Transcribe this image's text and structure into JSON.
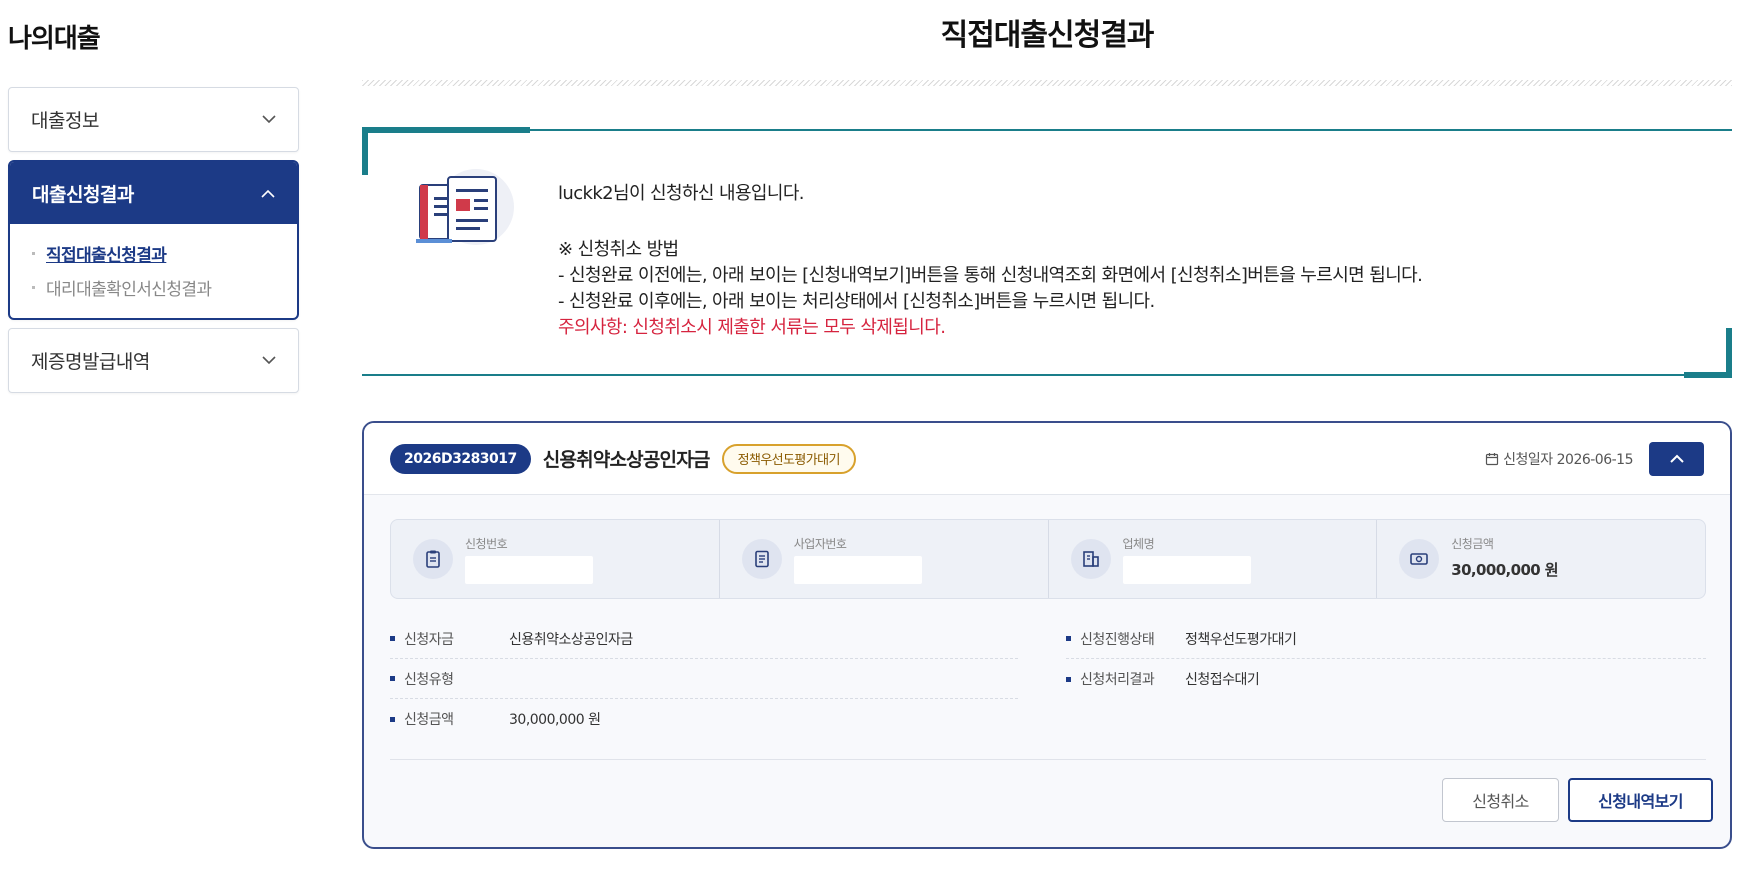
{
  "sidebar": {
    "title": "나의대출",
    "menus": [
      {
        "label": "대출정보"
      },
      {
        "label": "대출신청결과",
        "sub": [
          "직접대출신청결과",
          "대리대출확인서신청결과"
        ]
      },
      {
        "label": "제증명발급내역"
      }
    ]
  },
  "page": {
    "title": "직접대출신청결과"
  },
  "notice": {
    "line1": "luckk2님이 신청하신 내용입니다.",
    "heading": "※ 신청취소 방법",
    "line2": "- 신청완료 이전에는, 아래 보이는 [신청내역보기]버튼을 통해 신청내역조회 화면에서 [신청취소]버튼을 누르시면 됩니다.",
    "line3": "- 신청완료 이후에는, 아래 보이는 처리상태에서 [신청취소]버튼을 누르시면 됩니다.",
    "warning": "주의사항: 신청취소시 제출한 서류는 모두 삭제됩니다."
  },
  "card": {
    "number": "2026D3283017",
    "name": "신용취약소상공인자금",
    "status": "정책우선도평가대기",
    "date_label": "신청일자 2026-06-15",
    "summary": [
      {
        "label": "신청번호",
        "value": "",
        "icon": "clipboard-icon"
      },
      {
        "label": "사업자번호",
        "value": "",
        "icon": "document-icon"
      },
      {
        "label": "업체명",
        "value": "",
        "icon": "building-icon"
      },
      {
        "label": "신청금액",
        "value": "30,000,000 원",
        "icon": "money-icon"
      }
    ],
    "details_left": [
      {
        "key": "신청자금",
        "value": "신용취약소상공인자금"
      },
      {
        "key": "신청유형",
        "value": ""
      },
      {
        "key": "신청금액",
        "value": "30,000,000 원"
      }
    ],
    "details_right": [
      {
        "key": "신청진행상태",
        "value": "정책우선도평가대기"
      },
      {
        "key": "신청처리결과",
        "value": "신청접수대기"
      }
    ],
    "cancel_label": "신청취소",
    "view_label": "신청내역보기"
  },
  "colors": {
    "navy": "#1c3a86",
    "teal": "#1a7e8a",
    "warning": "#d6243f"
  }
}
